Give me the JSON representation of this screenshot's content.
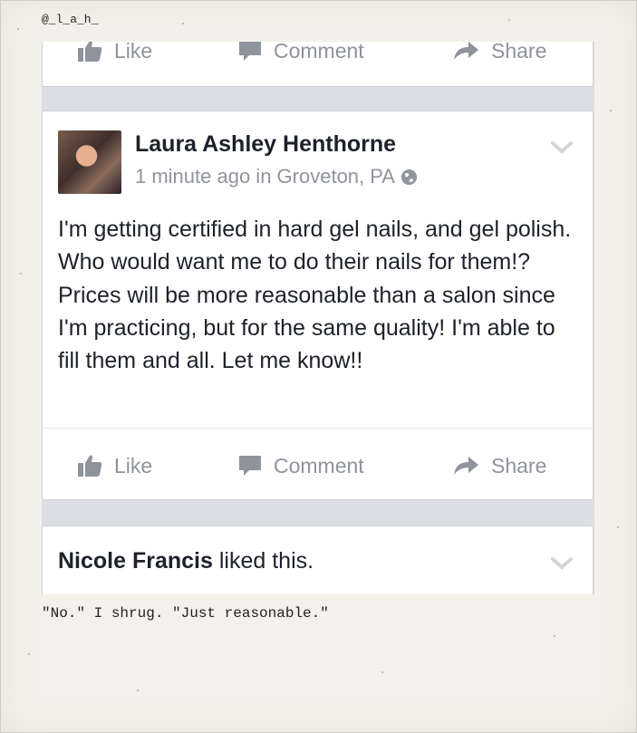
{
  "watermark": {
    "handle": "@_l_a_h_"
  },
  "caption": {
    "text": "\"No.\" I shrug. \"Just reasonable.\""
  },
  "top_actions": {
    "like": "Like",
    "comment": "Comment",
    "share": "Share"
  },
  "post": {
    "author": "Laura Ashley Henthorne",
    "meta": "1 minute ago in Groveton, PA",
    "body": "I'm getting certified in hard gel nails, and gel polish. Who would want me to do their nails for them!? Prices will be more reasonable than a salon since I'm practicing, but for the same quality! I'm able to fill them and all. Let me know!!",
    "actions": {
      "like": "Like",
      "comment": "Comment",
      "share": "Share"
    }
  },
  "activity": {
    "name": "Nicole Francis",
    "text": " liked this."
  },
  "colors": {
    "action_gray": "#8f939b",
    "text": "#1d2129",
    "meta_gray": "#90949c",
    "feed_bg": "#dcdee3"
  },
  "icons": [
    "thumbs-up-icon",
    "comment-bubble-icon",
    "share-arrow-icon",
    "globe-icon",
    "chevron-down-icon"
  ]
}
